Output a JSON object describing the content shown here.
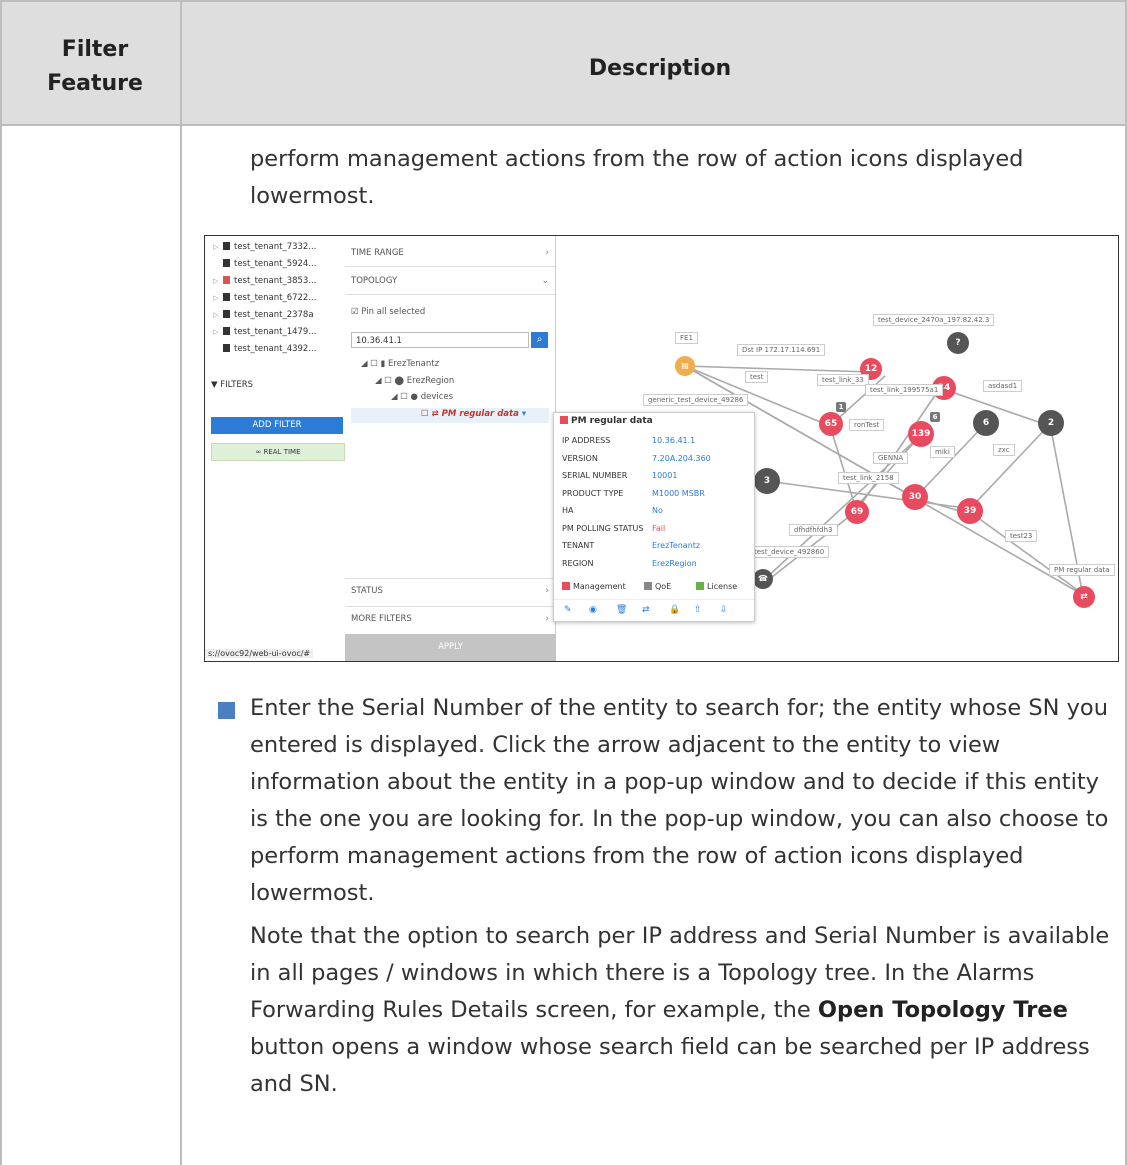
{
  "table": {
    "header_col1": "Filter Feature",
    "header_col2": "Description"
  },
  "intro_para": "perform management actions from the row of action icons displayed lowermost.",
  "screenshot": {
    "tree_items": [
      {
        "label": "test_tenant_7332...",
        "expand": true,
        "red": false
      },
      {
        "label": "test_tenant_5924...",
        "expand": false,
        "red": false
      },
      {
        "label": "test_tenant_3853...",
        "expand": true,
        "red": true
      },
      {
        "label": "test_tenant_6722...",
        "expand": true,
        "red": false
      },
      {
        "label": "test_tenant_2378a",
        "expand": true,
        "red": false
      },
      {
        "label": "test_tenant_1479...",
        "expand": true,
        "red": false
      },
      {
        "label": "test_tenant_4392...",
        "expand": false,
        "red": false
      }
    ],
    "filters_label": "FILTERS",
    "add_filter": "ADD FILTER",
    "real_time": "REAL TIME",
    "url": "s://ovoc92/web-ui-ovoc/#",
    "panel": {
      "time_range": "TIME RANGE",
      "topology": "TOPOLOGY",
      "pin_all": "Pin all selected",
      "search_value": "10.36.41.1",
      "tenant": "ErezTenantz",
      "region": "ErezRegion",
      "devices": "devices",
      "selected_device": "PM regular data",
      "status": "STATUS",
      "more_filters": "MORE FILTERS",
      "apply": "APPLY"
    },
    "popup": {
      "title": "PM regular data",
      "rows": [
        {
          "k": "IP ADDRESS",
          "v": "10.36.41.1"
        },
        {
          "k": "VERSION",
          "v": "7.20A.204.360"
        },
        {
          "k": "SERIAL NUMBER",
          "v": "10001"
        },
        {
          "k": "PRODUCT TYPE",
          "v": "M1000 MSBR"
        },
        {
          "k": "HA",
          "v": "No"
        },
        {
          "k": "PM POLLING STATUS",
          "v": "Fail"
        },
        {
          "k": "TENANT",
          "v": "ErezTenantz"
        },
        {
          "k": "REGION",
          "v": "ErezRegion"
        }
      ],
      "legend": [
        "Management",
        "QoE",
        "License"
      ]
    },
    "map": {
      "nodes": [
        {
          "label": "12"
        },
        {
          "label": "34"
        },
        {
          "label": "65"
        },
        {
          "label": "139"
        },
        {
          "label": "6"
        },
        {
          "label": "2"
        },
        {
          "label": "3"
        },
        {
          "label": "30"
        },
        {
          "label": "69"
        },
        {
          "label": "39"
        },
        {
          "label": "?"
        }
      ],
      "small_badges": [
        "1",
        "6"
      ],
      "tags": [
        "FE1",
        "Dst IP 172.17.114.691",
        "test",
        "test_link_33",
        "test_link_199575a1",
        "asdasd1",
        "generic_test_device_49286",
        "ronTest",
        "GENNA",
        "miki",
        "zxc",
        "test_link_2158",
        "dfhdfhfdh3",
        "test_device_492860",
        "test23",
        "PM regular data",
        "test_device_2470a_197.82.42.3"
      ]
    }
  },
  "bullet_para": "Enter the Serial Number of the entity to search for; the entity whose SN you entered is displayed. Click the arrow adjacent to the entity to view information about the entity in a pop-up window and to decide if this entity is the one you are looking for. In the pop-up window, you can also choose to perform management actions from the row of action icons displayed lowermost.",
  "note_para": {
    "part1": "Note that the option to search per IP address and Serial Number is available in all pages / windows in which there is a Topology tree. In the Alarms Forwarding Rules Details screen, for example, the ",
    "bold": "Open Topology Tree",
    "part2": " button opens a window whose search field can be searched per IP address and SN."
  }
}
